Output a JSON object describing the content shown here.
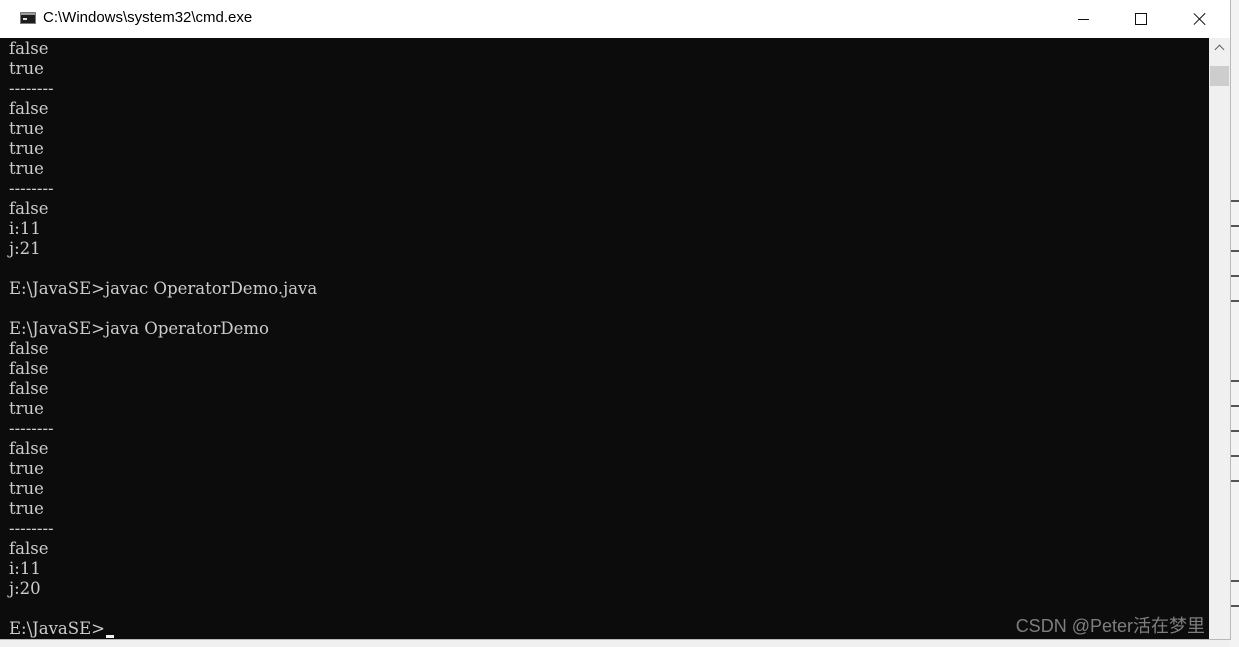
{
  "window": {
    "title": "C:\\Windows\\system32\\cmd.exe",
    "controls": {
      "minimize": "minimize",
      "maximize": "maximize",
      "close": "close"
    }
  },
  "console": {
    "background": "#0c0c0c",
    "foreground": "#cccccc",
    "lines": [
      "false",
      "true",
      "--------",
      "false",
      "true",
      "true",
      "true",
      "--------",
      "false",
      "i:11",
      "j:21",
      "",
      "E:\\JavaSE>javac OperatorDemo.java",
      "",
      "E:\\JavaSE>java OperatorDemo",
      "false",
      "false",
      "false",
      "true",
      "--------",
      "false",
      "true",
      "true",
      "true",
      "--------",
      "false",
      "i:11",
      "j:20",
      ""
    ],
    "prompt": "E:\\JavaSE>"
  },
  "watermark": "CSDN @Peter活在梦里",
  "icons": {
    "app": "console-app-icon",
    "scroll_up": "chevron-up-icon"
  }
}
